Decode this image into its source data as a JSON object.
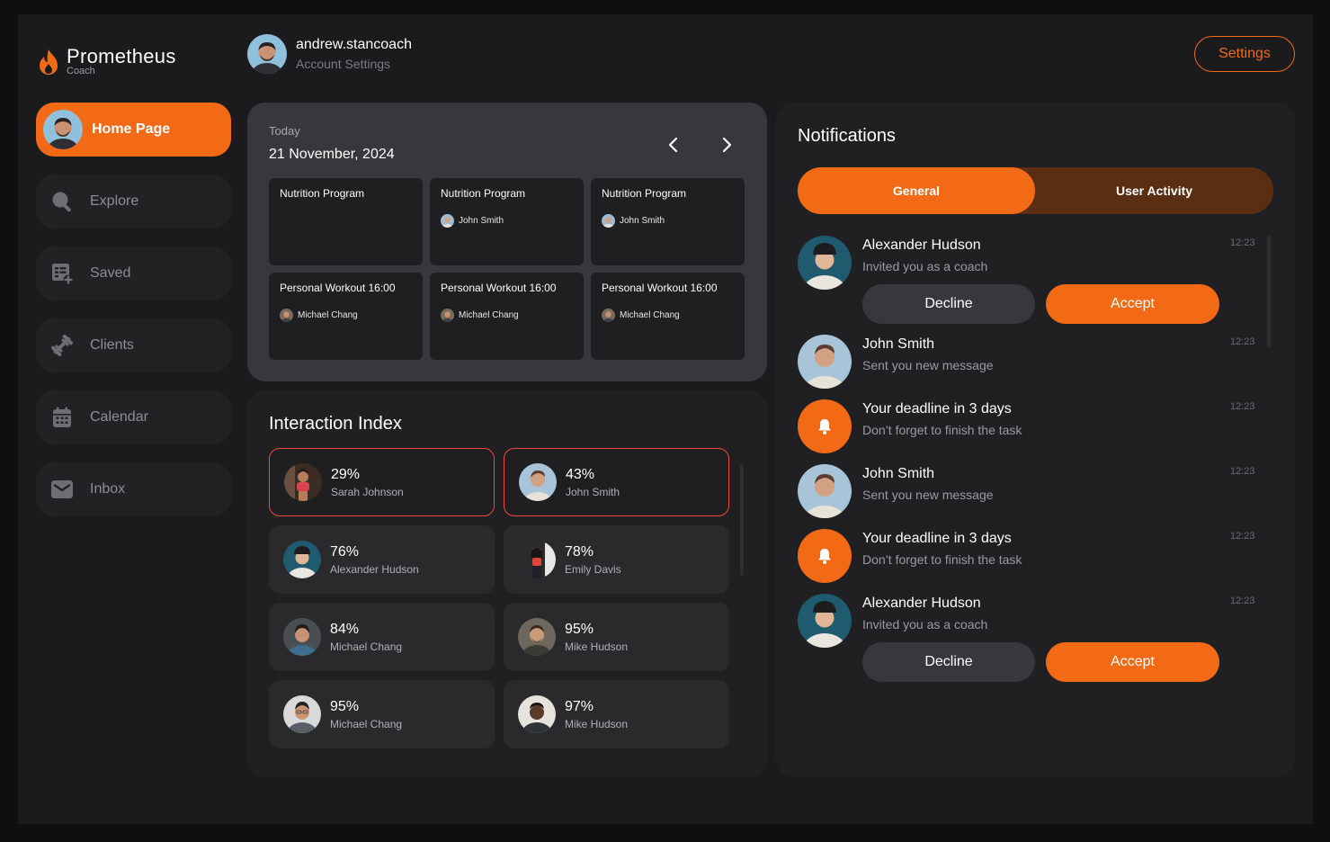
{
  "brand": {
    "name": "Prometheus",
    "sub": "Coach",
    "accent": "#f26a16"
  },
  "user": {
    "username": "andrew.stancoach",
    "subtitle": "Account Settings"
  },
  "header": {
    "settings_label": "Settings"
  },
  "nav": {
    "items": [
      {
        "label": "Home Page",
        "icon": "avatar"
      },
      {
        "label": "Explore",
        "icon": "search-icon"
      },
      {
        "label": "Saved",
        "icon": "saved-list-icon"
      },
      {
        "label": "Clients",
        "icon": "dumbbell-icon"
      },
      {
        "label": "Calendar",
        "icon": "calendar-icon"
      },
      {
        "label": "Inbox",
        "icon": "mail-icon"
      }
    ]
  },
  "calendar": {
    "today_label": "Today",
    "date": "21 November, 2024",
    "events": [
      {
        "title": "Nutrition Program",
        "person": ""
      },
      {
        "title": "Nutrition Program",
        "person": "John Smith"
      },
      {
        "title": "Nutrition Program",
        "person": "John Smith"
      },
      {
        "title": "Personal Workout 16:00",
        "person": "Michael Chang"
      },
      {
        "title": "Personal Workout 16:00",
        "person": "Michael Chang"
      },
      {
        "title": "Personal Workout 16:00",
        "person": "Michael Chang"
      }
    ]
  },
  "interaction": {
    "title": "Interaction Index",
    "cards": [
      {
        "pct": "29%",
        "name": "Sarah Johnson",
        "highlight": true
      },
      {
        "pct": "43%",
        "name": "John Smith",
        "highlight": true
      },
      {
        "pct": "76%",
        "name": "Alexander Hudson",
        "highlight": false
      },
      {
        "pct": "78%",
        "name": "Emily Davis",
        "highlight": false
      },
      {
        "pct": "84%",
        "name": "Michael Chang",
        "highlight": false
      },
      {
        "pct": "95%",
        "name": "Mike Hudson",
        "highlight": false
      },
      {
        "pct": "95%",
        "name": "Michael Chang",
        "highlight": false
      },
      {
        "pct": "97%",
        "name": "Mike Hudson",
        "highlight": false
      }
    ]
  },
  "notifications": {
    "title": "Notifications",
    "tabs": {
      "general": "General",
      "activity": "User Activity"
    },
    "items": [
      {
        "name": "Alexander Hudson",
        "desc": "Invited you as a coach",
        "time": "12:23",
        "decline": "Decline",
        "accept": "Accept"
      },
      {
        "name": "John Smith",
        "desc": "Sent you new message",
        "time": "12:23"
      },
      {
        "name": "Your deadline in 3 days",
        "desc": "Don’t forget to finish the task",
        "time": "12:23"
      },
      {
        "name": "John Smith",
        "desc": "Sent you new message",
        "time": "12:23"
      },
      {
        "name": "Your deadline in 3 days",
        "desc": "Don’t forget to finish the task",
        "time": "12:23"
      },
      {
        "name": "Alexander Hudson",
        "desc": "Invited you as a coach",
        "time": "12:23",
        "decline": "Decline",
        "accept": "Accept"
      }
    ]
  }
}
